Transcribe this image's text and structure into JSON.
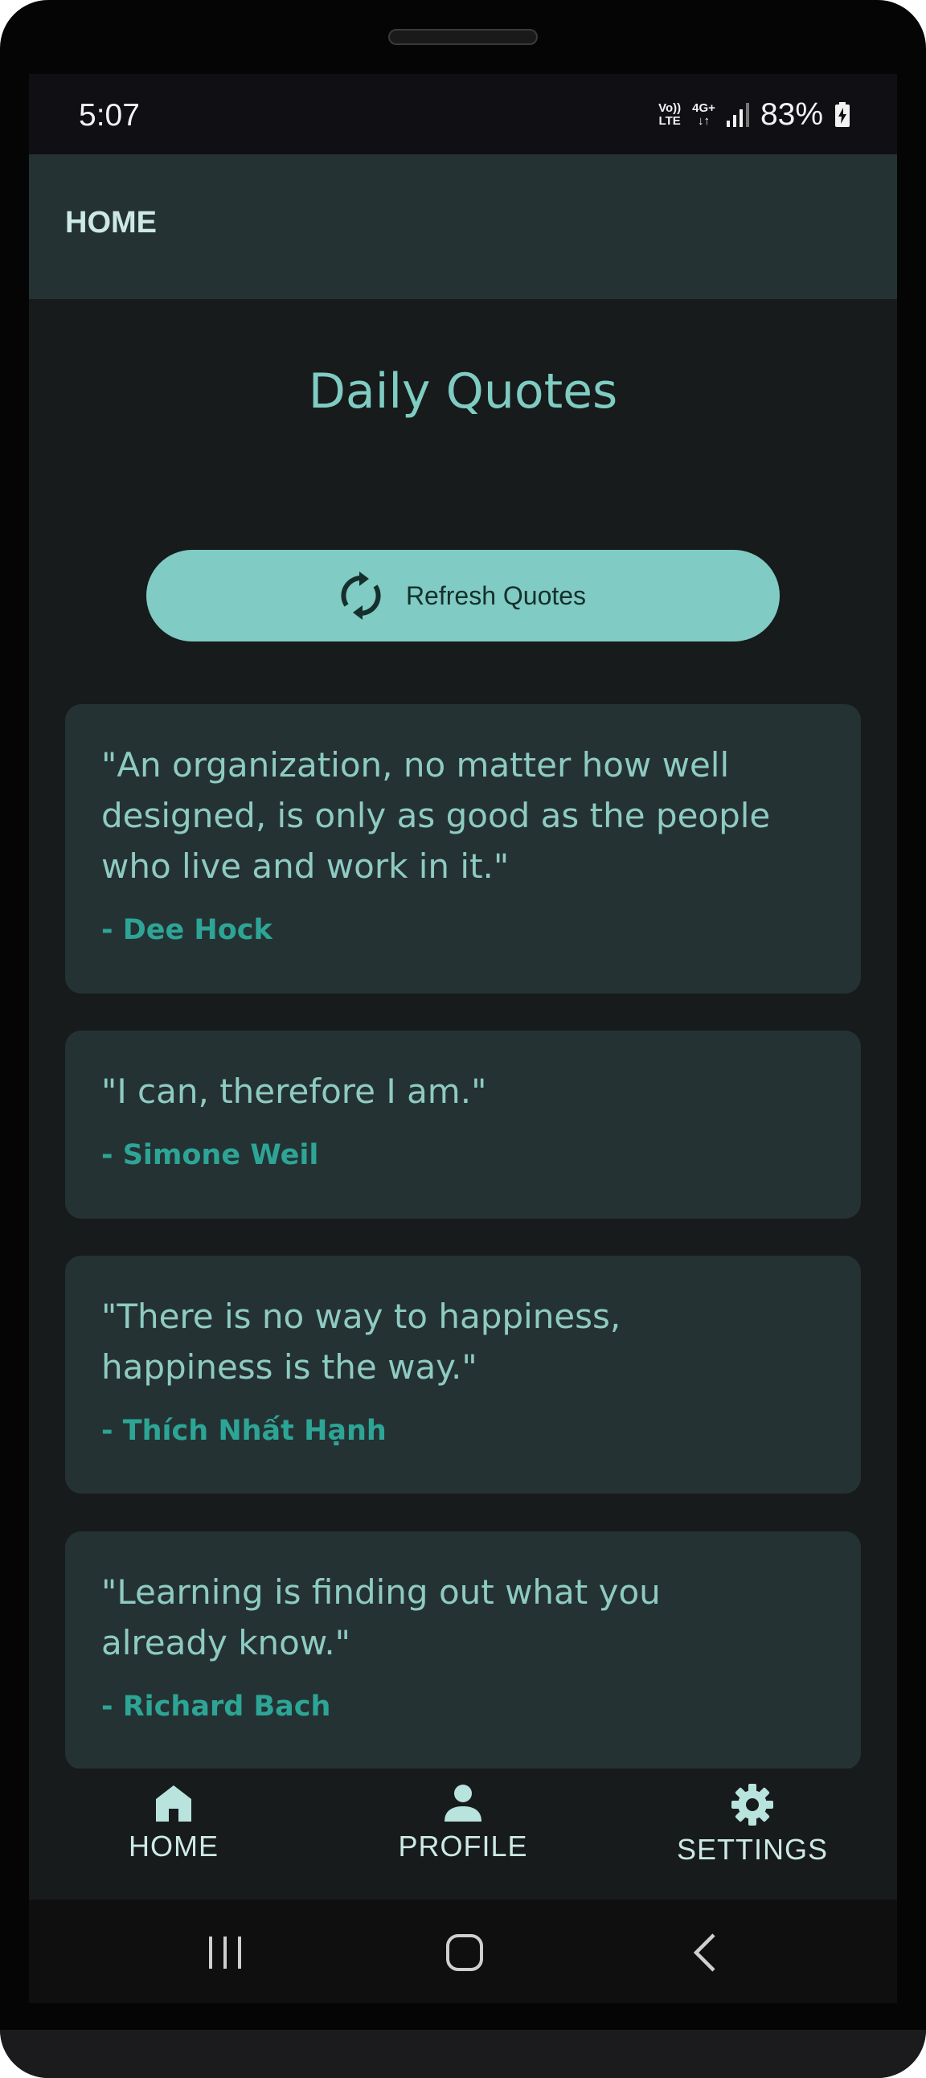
{
  "status_bar": {
    "time": "5:07",
    "volte_top": "Vo))",
    "volte_bottom": "LTE",
    "network_top": "4G+",
    "network_bottom": "↓↑",
    "battery_percent": "83%"
  },
  "app_bar": {
    "title": "HOME"
  },
  "page": {
    "title": "Daily Quotes"
  },
  "refresh_button": {
    "label": "Refresh Quotes"
  },
  "quotes": [
    {
      "lines": [
        "\"An organization, no matter how well",
        "designed, is only as good as the people",
        "who live and work in it.\""
      ],
      "author": "- Dee Hock"
    },
    {
      "lines": [
        "\"I can, therefore I am.\""
      ],
      "author": "- Simone Weil"
    },
    {
      "lines": [
        "\"There is no way to happiness,",
        "happiness is the way.\""
      ],
      "author": "- Thích Nhất Hạnh"
    },
    {
      "lines": [
        "\"Learning is finding out what you",
        "already know.\""
      ],
      "author": "- Richard Bach"
    }
  ],
  "bottom_nav": {
    "home": "HOME",
    "profile": "PROFILE",
    "settings": "SETTINGS"
  },
  "colors": {
    "background": "#171b1c",
    "surface": "#253233",
    "accent": "#80cbc4",
    "quote_text": "#8ecbc2",
    "author_text": "#2da596"
  },
  "icons": {
    "refresh": "refresh-icon",
    "home": "home-icon",
    "profile": "person-icon",
    "settings": "gear-icon",
    "recents": "recents-icon",
    "home_system": "system-home-icon",
    "back": "back-icon"
  }
}
